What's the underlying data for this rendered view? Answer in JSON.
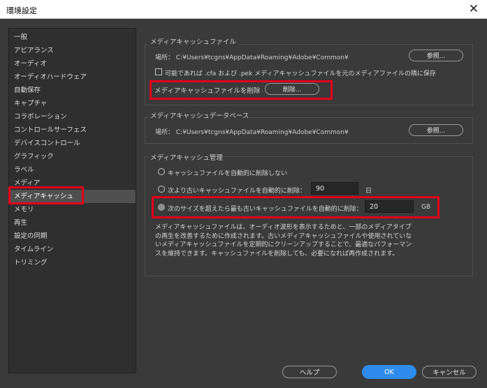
{
  "window": {
    "title": "環境設定",
    "close_glyph": "✕"
  },
  "sidebar": {
    "items": [
      {
        "label": "一般"
      },
      {
        "label": "アピアランス"
      },
      {
        "label": "オーディオ"
      },
      {
        "label": "オーディオハードウェア"
      },
      {
        "label": "自動保存"
      },
      {
        "label": "キャプチャ"
      },
      {
        "label": "コラボレーション"
      },
      {
        "label": "コントロールサーフェス"
      },
      {
        "label": "デバイスコントロール"
      },
      {
        "label": "グラフィック"
      },
      {
        "label": "ラベル"
      },
      {
        "label": "メディア"
      },
      {
        "label": "メディアキャッシュ"
      },
      {
        "label": "メモリ"
      },
      {
        "label": "再生"
      },
      {
        "label": "設定の同期"
      },
      {
        "label": "タイムライン"
      },
      {
        "label": "トリミング"
      }
    ],
    "selected": "メディアキャッシュ"
  },
  "cache_files": {
    "title": "メディアキャッシュファイル",
    "location": "場所： C:¥Users¥tcgns¥AppData¥Roaming¥Adobe¥Common¥",
    "browse": "参照...",
    "checkbox": "可能であれば .cfa および .pek メディアキャッシュファイルを元のメディアファイルの隣に保存",
    "delete_label": "メディアキャッシュファイルを削除",
    "delete_button": "削除..."
  },
  "cache_db": {
    "title": "メディアキャッシュデータベース",
    "location": "場所： C:¥Users¥tcgns¥AppData¥Roaming¥Adobe¥Common¥",
    "browse": "参照..."
  },
  "cache_mgmt": {
    "title": "メディアキャッシュ管理",
    "opt1": "キャッシュファイルを自動的に削除しない",
    "opt2": "次より古いキャッシュファイルを自動的に削除：",
    "opt2_value": "90",
    "opt2_unit": "日",
    "opt3": "次のサイズを超えたら最も古いキャッシュファイルを自動的に削除：",
    "opt3_value": "20",
    "opt3_unit": "GB",
    "description": "メディアキャッシュファイルは、オーディオ波形を表示するためと、一部のメディアタイプの再生を改善するために作成されます。古いメディアキャッシュファイルや使用されていないメディアキャッシュファイルを定期的にクリーンアップすることで、最適なパフォーマンスを維持できます。キャッシュファイルを削除しても、必要になれば再作成されます。"
  },
  "footer": {
    "help": "ヘルプ",
    "ok": "OK",
    "cancel": "キャンセル"
  },
  "colors": {
    "highlight": "#e2001a",
    "ok": "#2d8ceb",
    "background": "#3a3a3a"
  }
}
